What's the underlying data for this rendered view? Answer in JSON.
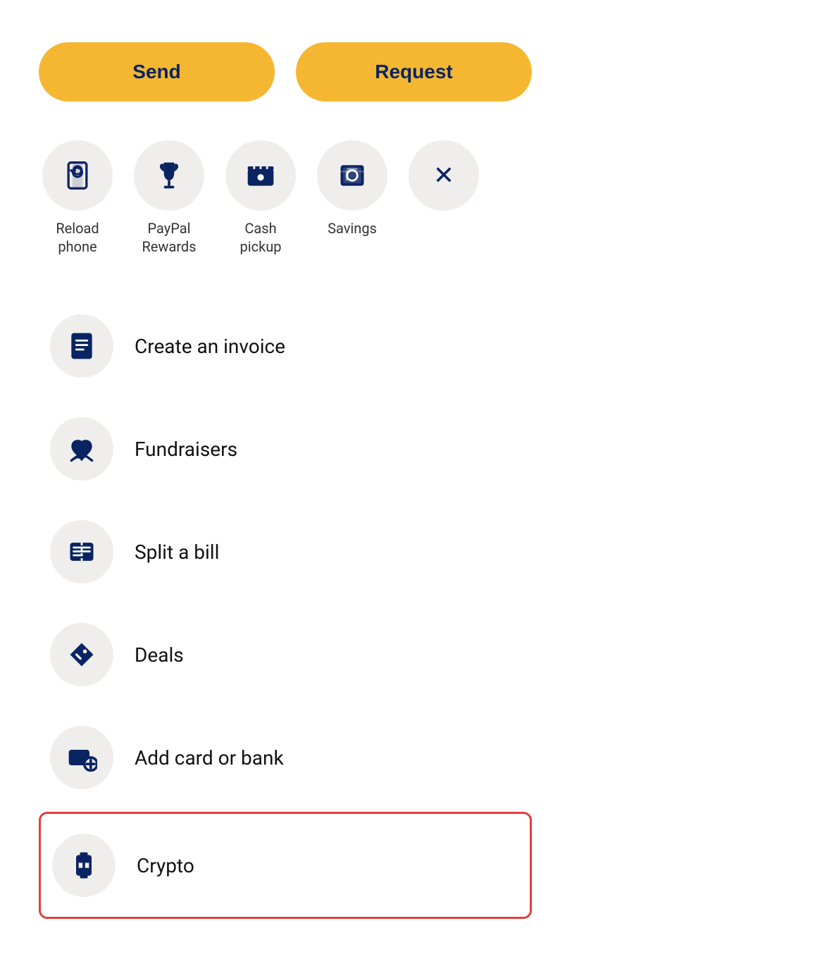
{
  "buttons": {
    "send_label": "Send",
    "request_label": "Request"
  },
  "quick_actions": [
    {
      "id": "reload-phone",
      "label": "Reload\nphone",
      "icon": "reload-phone-icon"
    },
    {
      "id": "paypal-rewards",
      "label": "PayPal\nRewards",
      "icon": "trophy-icon"
    },
    {
      "id": "cash-pickup",
      "label": "Cash\npickup",
      "icon": "cash-pickup-icon"
    },
    {
      "id": "savings",
      "label": "Savings",
      "icon": "savings-icon"
    },
    {
      "id": "close",
      "label": "",
      "icon": "close-icon"
    }
  ],
  "list_items": [
    {
      "id": "create-invoice",
      "label": "Create an invoice",
      "icon": "invoice-icon",
      "highlighted": false
    },
    {
      "id": "fundraisers",
      "label": "Fundraisers",
      "icon": "fundraisers-icon",
      "highlighted": false
    },
    {
      "id": "split-bill",
      "label": "Split a bill",
      "icon": "split-bill-icon",
      "highlighted": false
    },
    {
      "id": "deals",
      "label": "Deals",
      "icon": "deals-icon",
      "highlighted": false
    },
    {
      "id": "add-card-bank",
      "label": "Add card or bank",
      "icon": "add-card-icon",
      "highlighted": false
    },
    {
      "id": "crypto",
      "label": "Crypto",
      "icon": "crypto-icon",
      "highlighted": true
    }
  ],
  "colors": {
    "accent": "#F5B731",
    "dark_blue": "#0a2463",
    "icon_bg": "#f0eeec",
    "highlight_border": "#e53e3e"
  }
}
